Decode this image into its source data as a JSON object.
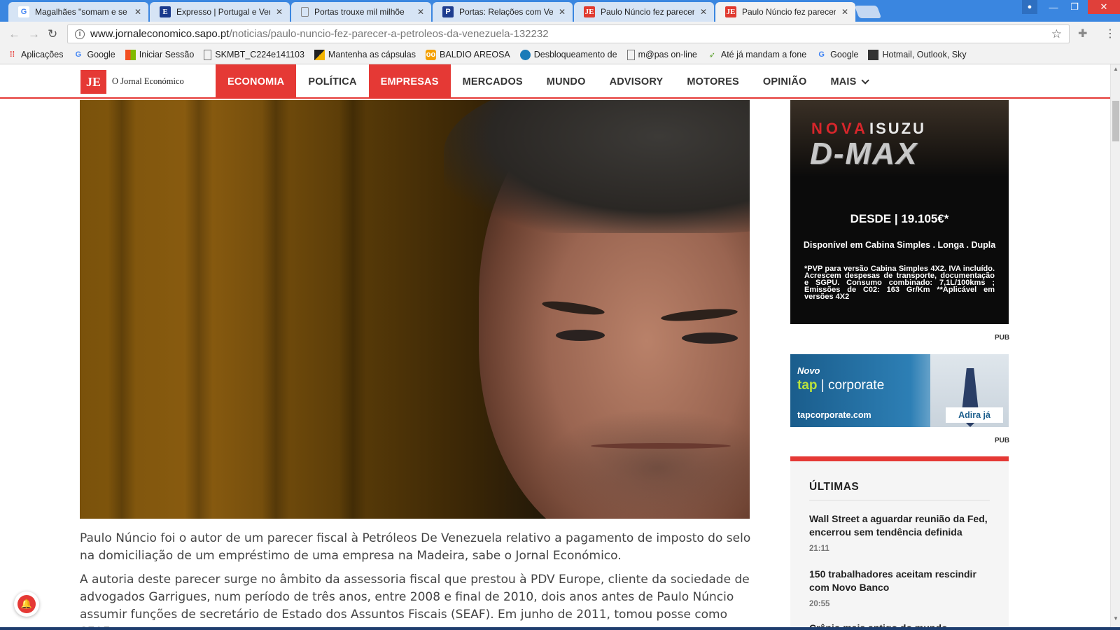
{
  "browser": {
    "tabs": [
      {
        "label": "Magalhães \"somam e se",
        "icon": "google-icon"
      },
      {
        "label": "Expresso | Portugal e Ver",
        "icon": "expresso-icon"
      },
      {
        "label": "Portas trouxe mil milhõe",
        "icon": "document-icon"
      },
      {
        "label": "Portas: Relações com Ve",
        "icon": "portal-icon"
      },
      {
        "label": "Paulo Núncio fez parecer",
        "icon": "je-icon"
      },
      {
        "label": "Paulo Núncio fez parecer",
        "icon": "je-icon"
      }
    ],
    "url_domain": "www.jornaleconomico.sapo.pt",
    "url_path": "/noticias/paulo-nuncio-fez-parecer-a-petroleos-da-venezuela-132232",
    "bookmarks": [
      {
        "label": "Aplicações",
        "icon": "apps-icon"
      },
      {
        "label": "Google",
        "icon": "google-icon"
      },
      {
        "label": "Iniciar Sessão",
        "icon": "microsoft-icon"
      },
      {
        "label": "SKMBT_C224e141103",
        "icon": "document-icon"
      },
      {
        "label": "Mantenha as cápsulas",
        "icon": "bookmark-icon"
      },
      {
        "label": "BALDIO AREOSA",
        "icon": "owl-icon"
      },
      {
        "label": "Desbloqueamento de",
        "icon": "globe-icon"
      },
      {
        "label": "m@pas on-line",
        "icon": "document-icon"
      },
      {
        "label": "Até já mandam a fone",
        "icon": "leaf-icon"
      },
      {
        "label": "Google",
        "icon": "google-icon"
      },
      {
        "label": "Hotmail, Outlook, Sky",
        "icon": "document-icon"
      }
    ]
  },
  "site": {
    "logo_mark": "JE",
    "logo_text": "O Jornal Económico",
    "nav": [
      "ECONOMIA",
      "POLÍTICA",
      "EMPRESAS",
      "MERCADOS",
      "MUNDO",
      "ADVISORY",
      "MOTORES",
      "OPINIÃO",
      "MAIS"
    ],
    "highlighted_nav": [
      "ECONOMIA",
      "EMPRESAS"
    ],
    "accent_color": "#e53935"
  },
  "article": {
    "paragraphs": [
      "Paulo Núncio foi o autor de um parecer fiscal à Petróleos De Venezuela relativo a pagamento de imposto do selo na domiciliação de um empréstimo de uma empresa na Madeira, sabe o Jornal Económico.",
      "A autoria deste parecer surge no âmbito da assessoria fiscal que prestou à PDV Europe, cliente da sociedade de advogados Garrigues, num período de três anos, entre 2008 e final de 2010, dois anos antes de Paulo Núncio assumir funções de secretário de Estado dos Assuntos Fiscais (SEAF). Em junho de 2011, tomou posse como SEAF"
    ]
  },
  "sidebar": {
    "ad1": {
      "nova": "NOVA",
      "brand": "ISUZU",
      "model": "D-MAX",
      "price": "DESDE | 19.105€*",
      "availability": "Disponível em Cabina Simples . Longa . Dupla",
      "fine_print": "*PVP para versão Cabina Simples 4X2. IVA incluído. Acrescem despesas de transporte, documentação e SGPU. Consumo combinado: 7,1L/100kms ; Emissões de C02: 163 Gr/Km **Aplicável em versões 4X2"
    },
    "pub_label": "PUB",
    "ad2": {
      "novo": "Novo",
      "tap": "tap",
      "corporate": "| corporate",
      "url": "tapcorporate.com",
      "cta": "Adira já"
    },
    "ultimas": {
      "title": "ÚLTIMAS",
      "items": [
        {
          "headline": "Wall Street a aguardar reunião da Fed, encerrou sem tendência definida",
          "time": "21:11"
        },
        {
          "headline": "150 trabalhadores aceitam rescindir com Novo Banco",
          "time": "20:55"
        },
        {
          "headline": "Crânio mais antigo do mundo",
          "time": ""
        }
      ]
    }
  }
}
